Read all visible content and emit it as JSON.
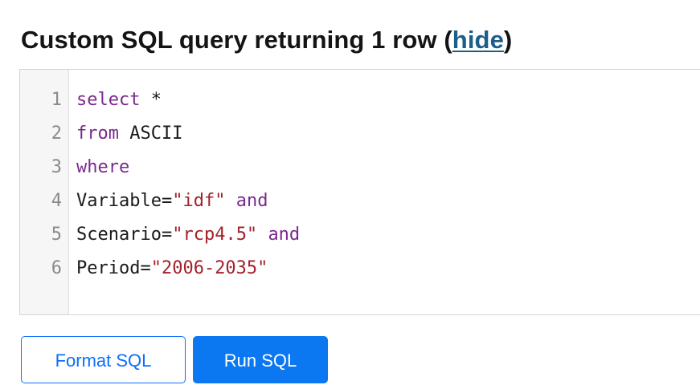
{
  "heading": {
    "title": "Custom SQL query returning 1 row (",
    "toggle_link": "hide",
    "suffix": ")"
  },
  "editor": {
    "lines": [
      {
        "number": "1",
        "tokens": [
          {
            "text": "select",
            "kind": "keyword"
          },
          {
            "text": " *",
            "kind": "plain"
          }
        ]
      },
      {
        "number": "2",
        "tokens": [
          {
            "text": "from",
            "kind": "keyword"
          },
          {
            "text": " ASCII",
            "kind": "plain"
          }
        ]
      },
      {
        "number": "3",
        "tokens": [
          {
            "text": "where",
            "kind": "keyword"
          }
        ]
      },
      {
        "number": "4",
        "tokens": [
          {
            "text": "Variable=",
            "kind": "plain"
          },
          {
            "text": "\"idf\"",
            "kind": "string"
          },
          {
            "text": " ",
            "kind": "plain"
          },
          {
            "text": "and",
            "kind": "keyword"
          }
        ]
      },
      {
        "number": "5",
        "tokens": [
          {
            "text": "Scenario=",
            "kind": "plain"
          },
          {
            "text": "\"rcp4.5\"",
            "kind": "string"
          },
          {
            "text": " ",
            "kind": "plain"
          },
          {
            "text": "and",
            "kind": "keyword"
          }
        ]
      },
      {
        "number": "6",
        "tokens": [
          {
            "text": "Period=",
            "kind": "plain"
          },
          {
            "text": "\"2006-2035\"",
            "kind": "string"
          }
        ]
      }
    ]
  },
  "buttons": {
    "format_label": "Format SQL",
    "run_label": "Run SQL"
  },
  "colors": {
    "keyword": "#7a2a8e",
    "string": "#a3212a",
    "primary": "#0b77f0",
    "link": "#1a5e89"
  }
}
